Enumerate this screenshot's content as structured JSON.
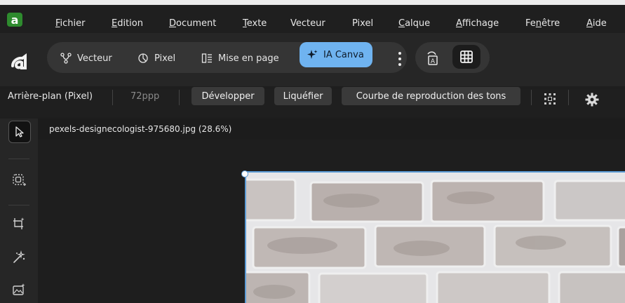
{
  "menu": {
    "logo": "a",
    "items": [
      {
        "pre": "",
        "ul": "F",
        "post": "ichier"
      },
      {
        "pre": "",
        "ul": "E",
        "post": "dition"
      },
      {
        "pre": "",
        "ul": "D",
        "post": "ocument"
      },
      {
        "pre": "",
        "ul": "T",
        "post": "exte"
      },
      {
        "pre": "Vecteur",
        "ul": "",
        "post": ""
      },
      {
        "pre": "Pixel",
        "ul": "",
        "post": ""
      },
      {
        "pre": "",
        "ul": "C",
        "post": "alque"
      },
      {
        "pre": "",
        "ul": "A",
        "post": "ffichage"
      },
      {
        "pre": "Fe",
        "ul": "n",
        "post": "être"
      },
      {
        "pre": "",
        "ul": "A",
        "post": "ide"
      }
    ]
  },
  "personas": {
    "logo": "a",
    "vector": "Vecteur",
    "pixel": "Pixel",
    "layout": "Mise en page",
    "canva": "IA Canva"
  },
  "context": {
    "layer": "Arrière-plan (Pixel)",
    "dpi": "72ppp",
    "develop": "Développer",
    "liquify": "Liquéfier",
    "curves": "Courbe de reproduction des tons"
  },
  "document": {
    "title": "pexels-designecologist-975680.jpg (28.6%)"
  },
  "colors": {
    "accent": "#6fb3f0",
    "logo_green": "#2e8b2e",
    "selection": "#5b9bd5"
  }
}
